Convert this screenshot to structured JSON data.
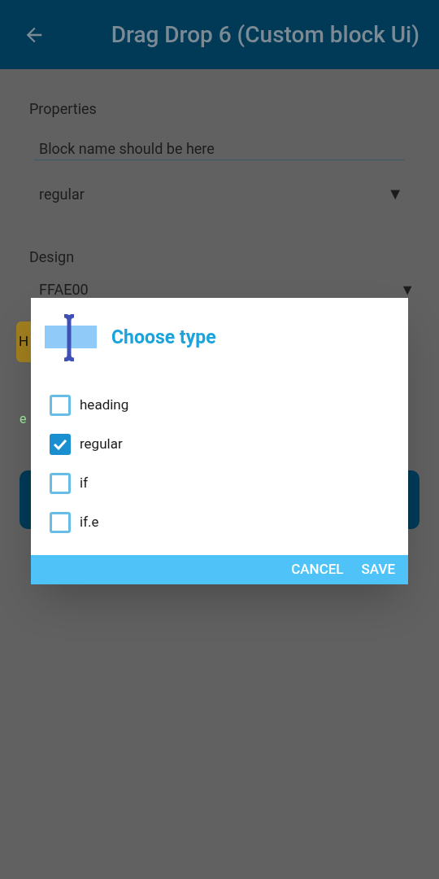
{
  "app_bar": {
    "title": "Drag Drop 6 (Custom block Ui)"
  },
  "properties": {
    "heading": "Properties",
    "name_field": {
      "value": "Block name should be here"
    },
    "type_dropdown": {
      "value": "regular",
      "arrow": "▼"
    }
  },
  "design": {
    "heading": "Design",
    "color_dropdown": {
      "value": "FFAE00",
      "arrow": "▼"
    },
    "preview_block": {
      "label": "H"
    },
    "note": "e"
  },
  "dialog": {
    "title": "Choose type",
    "options": [
      {
        "label": "heading",
        "checked": false
      },
      {
        "label": "regular",
        "checked": true
      },
      {
        "label": "if",
        "checked": false
      },
      {
        "label": "if.e",
        "checked": false
      }
    ],
    "buttons": [
      "CANCEL",
      "SAVE"
    ]
  }
}
